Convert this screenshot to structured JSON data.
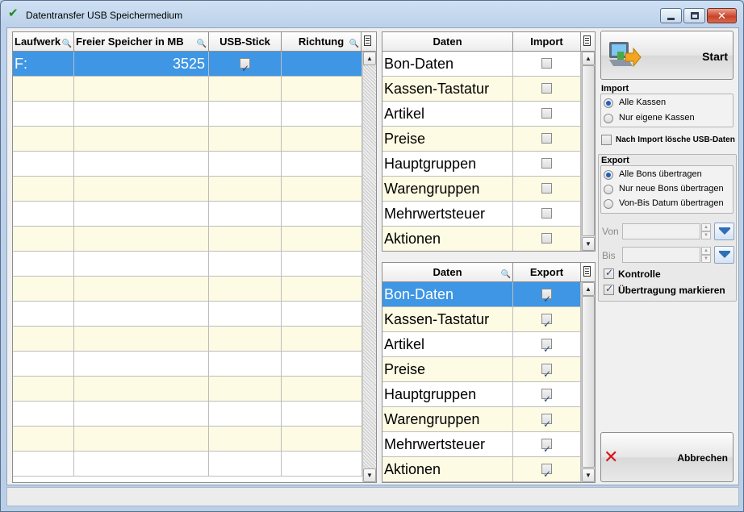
{
  "window": {
    "title": "Datentransfer USB Speichermedium"
  },
  "drives": {
    "columns": [
      "Laufwerk",
      "Freier Speicher in MB",
      "USB-Stick",
      "Richtung"
    ],
    "rows": [
      {
        "laufwerk": "F:",
        "speicher": "3525",
        "usb_stick": true,
        "richtung": ""
      }
    ]
  },
  "import_table": {
    "columns": [
      "Daten",
      "Import"
    ],
    "rows": [
      {
        "daten": "Bon-Daten",
        "checked": false
      },
      {
        "daten": "Kassen-Tastatur",
        "checked": false
      },
      {
        "daten": "Artikel",
        "checked": false
      },
      {
        "daten": "Preise",
        "checked": false
      },
      {
        "daten": "Hauptgruppen",
        "checked": false
      },
      {
        "daten": "Warengruppen",
        "checked": false
      },
      {
        "daten": "Mehrwertsteuer",
        "checked": false
      },
      {
        "daten": "Aktionen",
        "checked": false
      }
    ]
  },
  "export_table": {
    "columns": [
      "Daten",
      "Export"
    ],
    "rows": [
      {
        "daten": "Bon-Daten",
        "checked": true
      },
      {
        "daten": "Kassen-Tastatur",
        "checked": true
      },
      {
        "daten": "Artikel",
        "checked": true
      },
      {
        "daten": "Preise",
        "checked": true
      },
      {
        "daten": "Hauptgruppen",
        "checked": true
      },
      {
        "daten": "Warengruppen",
        "checked": true
      },
      {
        "daten": "Mehrwertsteuer",
        "checked": true
      },
      {
        "daten": "Aktionen",
        "checked": true
      }
    ]
  },
  "panel": {
    "start_label": "Start",
    "import_title": "Import",
    "import_options": [
      {
        "label": "Alle Kassen",
        "selected": true
      },
      {
        "label": "Nur eigene Kassen",
        "selected": false
      }
    ],
    "delete_after_import": {
      "label": "Nach Import lösche USB-Daten",
      "checked": false
    },
    "export_title": "Export",
    "export_options": [
      {
        "label": "Alle Bons übertragen",
        "selected": true
      },
      {
        "label": "Nur neue Bons übertragen",
        "selected": false
      },
      {
        "label": "Von-Bis Datum übertragen",
        "selected": false
      }
    ],
    "von_label": "Von",
    "bis_label": "Bis",
    "kontrolle": {
      "label": "Kontrolle",
      "checked": true
    },
    "uebertragung": {
      "label": "Übertragung markieren",
      "checked": true
    },
    "cancel_label": "Abbrechen"
  },
  "icons": {
    "title": "checkmark-icon",
    "start": "computer-transfer-icon",
    "cancel": "red-x-icon",
    "key": "key-icon",
    "column_chooser": "column-chooser-icon"
  },
  "colors": {
    "selection": "#3e96e4",
    "alt_row": "#fdfbe3"
  }
}
